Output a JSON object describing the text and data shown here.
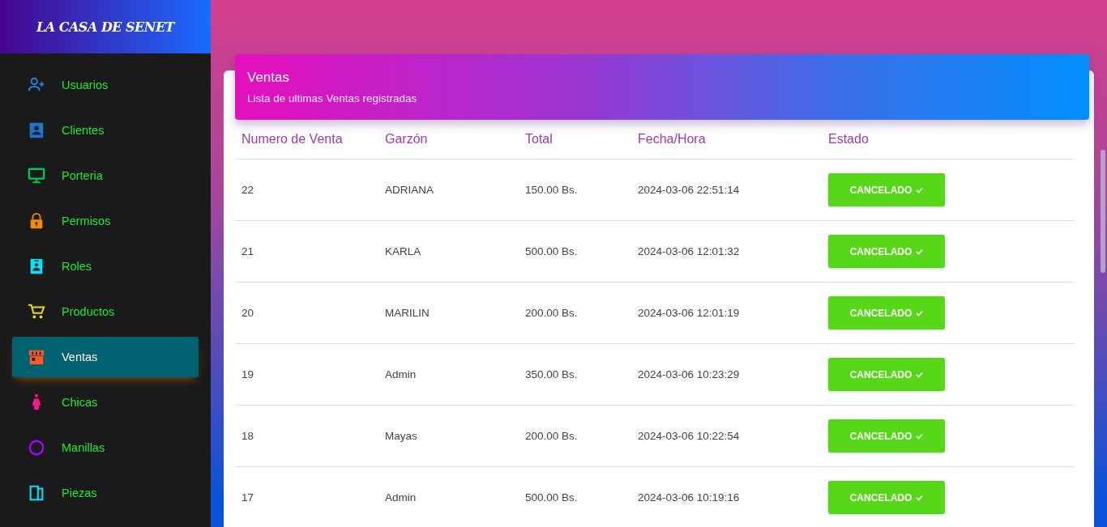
{
  "sidebar": {
    "brand": "LA CASA DE SENET",
    "items": [
      {
        "label": "Usuarios",
        "color": "#1e88e5",
        "selected": false
      },
      {
        "label": "Clientes",
        "color": "#1976d2",
        "selected": false
      },
      {
        "label": "Porteria",
        "color": "#00c853",
        "selected": false
      },
      {
        "label": "Permisos",
        "color": "#f08c00",
        "selected": false
      },
      {
        "label": "Roles",
        "color": "#00e5ff",
        "selected": false
      },
      {
        "label": "Productos",
        "color": "#e4e400",
        "selected": false
      },
      {
        "label": "Ventas",
        "color": "#ff5722",
        "selected": true
      },
      {
        "label": "Chicas",
        "color": "#ff1493",
        "selected": false
      },
      {
        "label": "Manillas",
        "color": "#aa00ff",
        "selected": false
      },
      {
        "label": "Piezas",
        "color": "#00e5ff",
        "selected": false
      }
    ]
  },
  "card": {
    "title": "Ventas",
    "subtitle": "Lista de ultimas Ventas registradas"
  },
  "table": {
    "columns": [
      "Numero de Venta",
      "Garzón",
      "Total",
      "Fecha/Hora",
      "Estado"
    ],
    "rows": [
      {
        "numero": "22",
        "garzon": "ADRIANA",
        "total": "150.00 Bs.",
        "fecha": "2024-03-06 22:51:14",
        "estado": "CANCELADO"
      },
      {
        "numero": "21",
        "garzon": "KARLA",
        "total": "500.00 Bs.",
        "fecha": "2024-03-06 12:01:32",
        "estado": "CANCELADO"
      },
      {
        "numero": "20",
        "garzon": "MARILIN",
        "total": "200.00 Bs.",
        "fecha": "2024-03-06 12:01:19",
        "estado": "CANCELADO"
      },
      {
        "numero": "19",
        "garzon": "Admin",
        "total": "350.00 Bs.",
        "fecha": "2024-03-06 10:23:29",
        "estado": "CANCELADO"
      },
      {
        "numero": "18",
        "garzon": "Mayas",
        "total": "200.00 Bs.",
        "fecha": "2024-03-06 10:22:54",
        "estado": "CANCELADO"
      },
      {
        "numero": "17",
        "garzon": "Admin",
        "total": "500.00 Bs.",
        "fecha": "2024-03-06 10:19:16",
        "estado": "CANCELADO"
      }
    ]
  }
}
